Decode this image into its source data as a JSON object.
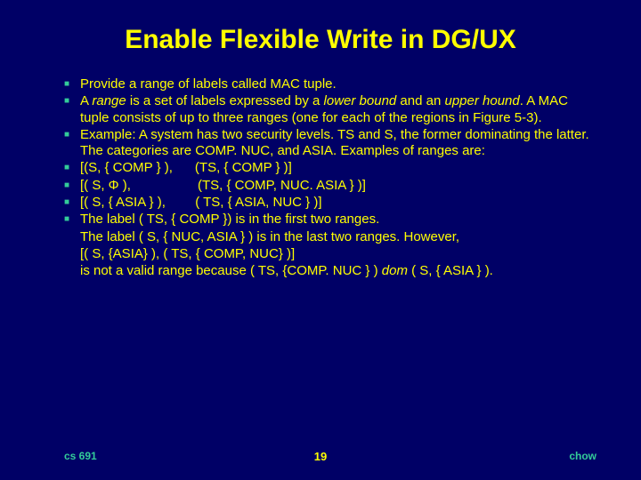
{
  "title": "Enable Flexible Write in DG/UX",
  "items": [
    {
      "bullet": true,
      "html": "Provide a range of labels called MAC tuple."
    },
    {
      "bullet": true,
      "html": "A <span class='i'>range</span> is a set of labels expressed by a <span class='i'>lower bound</span> and an <span class='i'>upper hound</span>. A MAC tuple consists of up to three ranges (one for each of the regions in Figure 5-3)."
    },
    {
      "bullet": true,
      "html": "Example: A system has two security levels. TS and S, the former dominating the latter. The categories are COMP. NUC, and ASIA. Examples of ranges are:"
    },
    {
      "bullet": true,
      "html": "[(S, { COMP } ), &nbsp;&nbsp;&nbsp;&nbsp;&nbsp;(TS, { COMP } )]"
    },
    {
      "bullet": true,
      "html": "[( S, &#934; ), &nbsp;&nbsp;&nbsp;&nbsp;&nbsp;&nbsp;&nbsp;&nbsp;&nbsp;&nbsp;&nbsp;&nbsp;&nbsp;&nbsp;&nbsp;&nbsp;&nbsp;(TS, { COMP, NUC. ASIA } )]"
    },
    {
      "bullet": true,
      "html": "[( S, { ASIA } ), &nbsp;&nbsp;&nbsp;&nbsp;&nbsp;&nbsp;&nbsp;( TS, { ASIA, NUC } )]"
    },
    {
      "bullet": true,
      "html": "The label ( TS, { COMP }) is in the first two ranges."
    },
    {
      "bullet": false,
      "html": "The label ( S, { NUC, ASIA } ) is in the last two ranges. However,"
    },
    {
      "bullet": false,
      "html": "[( S, {ASIA} ), ( TS, { COMP, NUC} )]"
    },
    {
      "bullet": false,
      "html": "is not a valid range because ( TS, {COMP. NUC } ) <span class='i'>dom</span> ( S, { ASIA } )."
    }
  ],
  "footer": {
    "left": "cs 691",
    "center": "19",
    "right": "chow"
  }
}
